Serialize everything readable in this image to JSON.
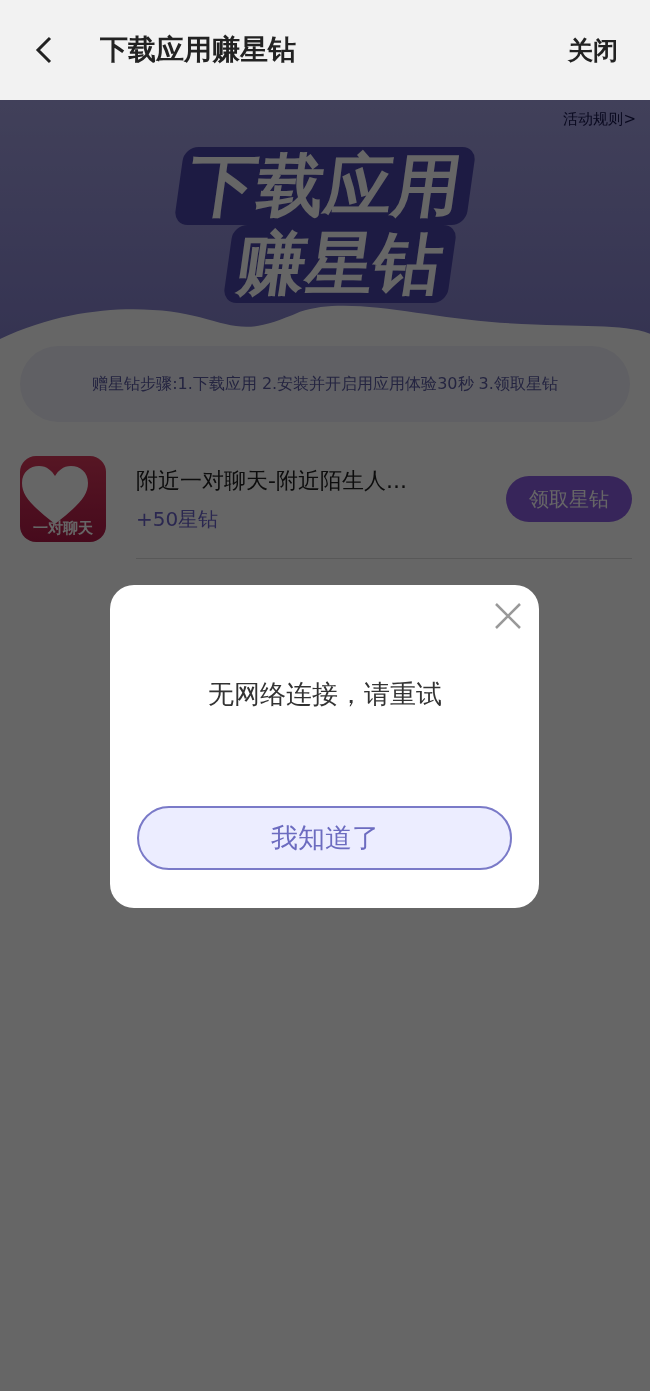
{
  "header": {
    "title": "下载应用赚星钻",
    "close": "关闭"
  },
  "banner": {
    "title_line_1": "下载应用",
    "title_line_2": "赚星钻",
    "rules_link": "活动规则>"
  },
  "steps": "赠星钻步骤:1.下载应用 2.安装并开启用应用体验30秒 3.领取星钻",
  "apps": [
    {
      "icon_label": "一对聊天",
      "name": "附近一对聊天-附近陌生人...",
      "reward": "+50星钻",
      "action": "领取星钻"
    }
  ],
  "dialog": {
    "message": "无网络连接，请重试",
    "button": "我知道了"
  }
}
